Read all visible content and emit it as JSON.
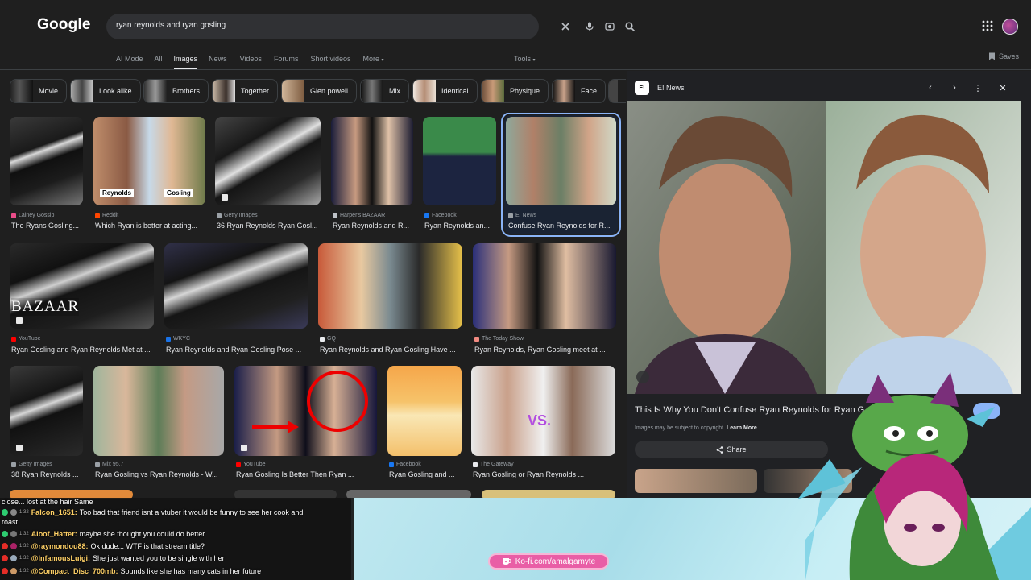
{
  "app": {
    "logo": "Google"
  },
  "search": {
    "query": "ryan reynolds and ryan gosling"
  },
  "tabs": [
    {
      "label": "AI Mode",
      "active": false
    },
    {
      "label": "All",
      "active": false
    },
    {
      "label": "Images",
      "active": true
    },
    {
      "label": "News",
      "active": false
    },
    {
      "label": "Videos",
      "active": false
    },
    {
      "label": "Forums",
      "active": false
    },
    {
      "label": "Short videos",
      "active": false
    },
    {
      "label": "More",
      "active": false
    }
  ],
  "tools_label": "Tools",
  "saves_label": "Saves",
  "chips": [
    {
      "label": "Movie"
    },
    {
      "label": "Look alike"
    },
    {
      "label": "Brothers"
    },
    {
      "label": "Together"
    },
    {
      "label": "Glen powell"
    },
    {
      "label": "Mix"
    },
    {
      "label": "Identical"
    },
    {
      "label": "Physique"
    },
    {
      "label": "Face"
    }
  ],
  "results": [
    {
      "source": "Lainey Gossip",
      "title": "The Ryans Gosling..."
    },
    {
      "source": "Reddit",
      "title": "Which Ryan is better at acting...",
      "labels": [
        "Reynolds",
        "Gosling"
      ]
    },
    {
      "source": "Getty Images",
      "title": "36 Ryan Reynolds Ryan Gosl..."
    },
    {
      "source": "Harper's BAZAAR",
      "title": "Ryan Reynolds and R..."
    },
    {
      "source": "Facebook",
      "title": "Ryan Reynolds an..."
    },
    {
      "source": "E! News",
      "title": "Confuse Ryan Reynolds for R..."
    },
    {
      "source": "YouTube",
      "title": "Ryan Gosling and Ryan Reynolds Met at ...",
      "overlay": "BAZAAR"
    },
    {
      "source": "WKYC",
      "title": "Ryan Reynolds and Ryan Gosling Pose ..."
    },
    {
      "source": "GQ",
      "title": "Ryan Reynolds and Ryan Gosling Have ..."
    },
    {
      "source": "The Today Show",
      "title": "Ryan Reynolds, Ryan Gosling meet at ..."
    },
    {
      "source": "Getty Images",
      "title": "38 Ryan Reynolds ..."
    },
    {
      "source": "Mix 95.7",
      "title": "Ryan Gosling vs Ryan Reynolds - W..."
    },
    {
      "source": "YouTube",
      "title": "Ryan Gosling Is Better Then Ryan ..."
    },
    {
      "source": "Facebook",
      "title": "Ryan Gosling and ..."
    },
    {
      "source": "The Gateway",
      "title": "Ryan Gosling or Ryan Reynolds ...",
      "overlay": "VS."
    }
  ],
  "panel": {
    "source": "E! News",
    "title": "This Is Why You Don't Confuse Ryan Reynolds for Ryan G",
    "note": "Images may be subject to copyright.",
    "note_link": "Learn More",
    "share_label": "Share"
  },
  "chat": {
    "top_line": "close... lost at the hair  Same",
    "messages": [
      {
        "user": "Falcon_1651:",
        "time": "1:32",
        "text": "Too bad that friend isnt a vtuber it would be funny to see her cook and",
        "cont": "roast"
      },
      {
        "user": "Aloof_Hatter:",
        "time": "1:32",
        "text": "maybe she thought you could do better"
      },
      {
        "user": "@raymondou88:",
        "time": "1:32",
        "text": "Ok dude... WTF is that stream title?"
      },
      {
        "user": "@InfamousLuigi:",
        "time": "1:32",
        "text": "She just wanted you to be single with her"
      },
      {
        "user": "@Compact_Disc_700mb:",
        "time": "1:32",
        "text": "Sounds like she has many cats in her future"
      }
    ]
  },
  "kofi": {
    "label": "Ko-fi.com/amalgamyte"
  }
}
